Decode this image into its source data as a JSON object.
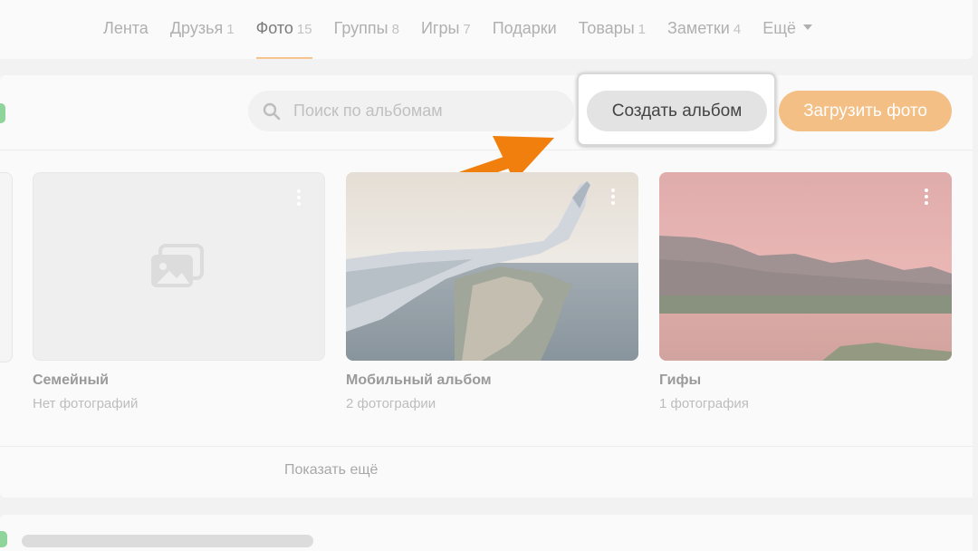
{
  "nav": {
    "tabs": [
      {
        "label": "Лента",
        "count": ""
      },
      {
        "label": "Друзья",
        "count": "1"
      },
      {
        "label": "Фото",
        "count": "15",
        "active": true
      },
      {
        "label": "Группы",
        "count": "8"
      },
      {
        "label": "Игры",
        "count": "7"
      },
      {
        "label": "Подарки",
        "count": ""
      },
      {
        "label": "Товары",
        "count": "1"
      },
      {
        "label": "Заметки",
        "count": "4"
      },
      {
        "label": "Ещё",
        "count": ""
      }
    ]
  },
  "albums": {
    "search_placeholder": "Поиск по альбомам",
    "create_label": "Создать альбом",
    "upload_label": "Загрузить фото",
    "items": [
      {
        "title": "Семейный",
        "subtitle": "Нет фотографий"
      },
      {
        "title": "Мобильный альбом",
        "subtitle": "2 фотографии"
      },
      {
        "title": "Гифы",
        "subtitle": "1 фотография"
      }
    ],
    "show_more": "Показать ещё"
  },
  "colors": {
    "accent": "#f4bf85",
    "arrow": "#f07f0e",
    "active_tab_underline": "#f5c48f"
  },
  "icons": [
    "search-icon",
    "caret-down-icon",
    "photos-icon",
    "kebab-menu-icon",
    "arrow-pointer-icon"
  ]
}
